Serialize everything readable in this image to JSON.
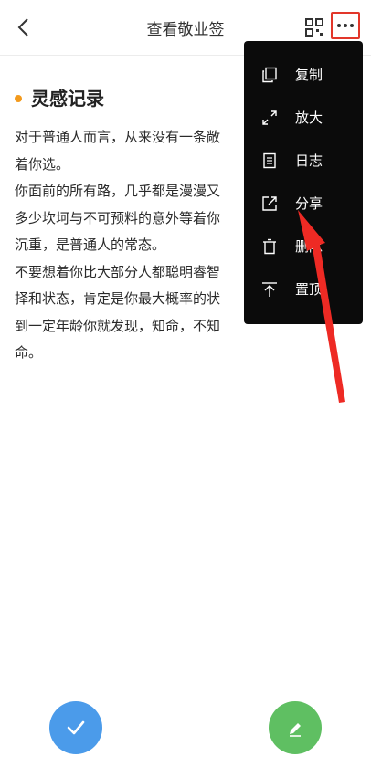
{
  "header": {
    "title": "查看敬业签"
  },
  "note": {
    "title": "灵感记录",
    "lines": [
      "对于普通人而言，从来没有一条敞",
      "着你选。",
      "你面前的所有路，几乎都是漫漫又",
      "多少坎坷与不可预料的意外等着你",
      "沉重，是普通人的常态。",
      "不要想着你比大部分人都聪明睿智",
      "择和状态，肯定是你最大概率的状",
      "到一定年龄你就发现，知命，不知",
      "命。"
    ]
  },
  "menu": {
    "items": [
      {
        "label": "复制",
        "icon": "copy-icon"
      },
      {
        "label": "放大",
        "icon": "expand-icon"
      },
      {
        "label": "日志",
        "icon": "log-icon"
      },
      {
        "label": "分享",
        "icon": "share-icon"
      },
      {
        "label": "删除",
        "icon": "trash-icon"
      },
      {
        "label": "置顶",
        "icon": "pin-top-icon"
      }
    ]
  },
  "colors": {
    "accent_dot": "#f39a1c",
    "highlight_border": "#e2362a",
    "menu_bg": "#0b0b0b",
    "fab_check": "#4b9bea",
    "fab_edit": "#5fbf62",
    "annotation_arrow": "#ee2a24"
  }
}
